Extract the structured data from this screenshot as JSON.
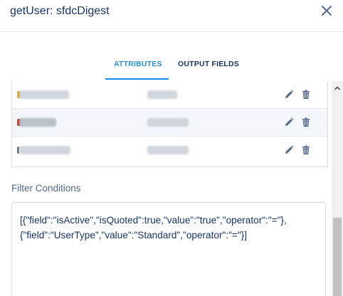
{
  "header": {
    "title": "getUser: sfdcDigest",
    "close_icon": "close-icon"
  },
  "tabs": [
    {
      "label": "ATTRIBUTES",
      "active": true
    },
    {
      "label": "OUTPUT FIELDS",
      "active": false
    }
  ],
  "attributes_table": {
    "rows": [
      {
        "name": "(redacted)",
        "value": "(redacted)",
        "edit_icon": "pencil-icon",
        "delete_icon": "trash-icon",
        "marker_color": "#d9a441"
      },
      {
        "name": "(redacted)",
        "value": "(redacted)",
        "edit_icon": "pencil-icon",
        "delete_icon": "trash-icon",
        "marker_color": "#c0392b"
      },
      {
        "name": "(redacted)",
        "value": "(redacted)",
        "edit_icon": "pencil-icon",
        "delete_icon": "trash-icon",
        "marker_color": "#6b6b6b"
      }
    ]
  },
  "filter_conditions": {
    "label": "Filter Conditions",
    "value_line1": "[{\"field\":\"isActive\",\"isQuoted\":true,\"value\":\"true\",\"operator\":\"=\"},",
    "value_line2": "{\"field\":\"UserType\",\"value\":\"Standard\",\"operator\":\"=\"}]"
  },
  "colors": {
    "accent": "#1589ee",
    "tab_active_text": "#2d8ccb",
    "text": "#16325c",
    "label": "#54698d",
    "icon": "#54698d"
  }
}
